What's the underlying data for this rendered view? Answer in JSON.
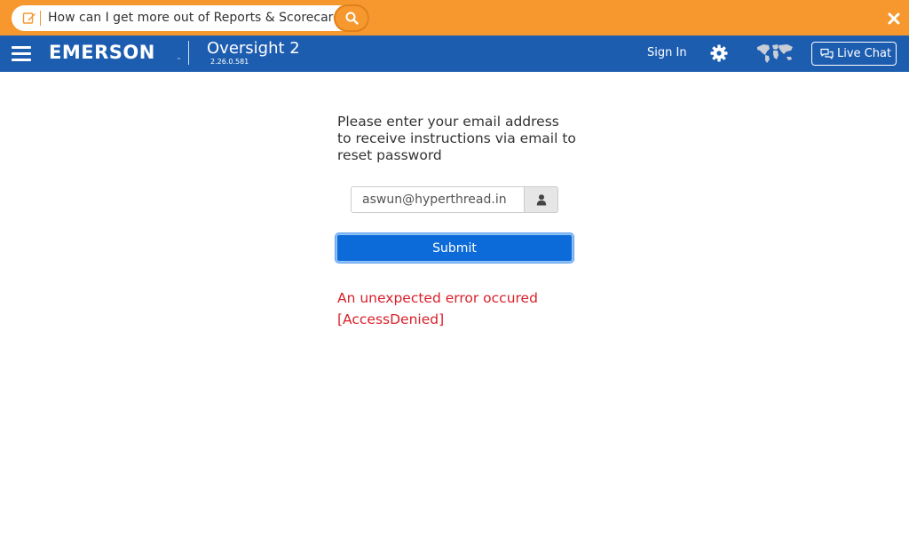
{
  "help_bar": {
    "query": "How can I get more out of Reports & Scorecards?",
    "accent_color": "#f7982f",
    "icons": {
      "edit": "edit-icon",
      "search": "search-icon",
      "close": "close-icon"
    }
  },
  "nav": {
    "brand": "EMERSON",
    "brand_tm": "™",
    "product": "Oversight 2",
    "version": "2.26.0.581",
    "sign_in": "Sign In",
    "live_chat": "Live Chat",
    "bg_color": "#1d5db0",
    "icons": {
      "menu": "hamburger-menu-icon",
      "settings": "gear-icon",
      "region": "world-map-icon",
      "chat": "chat-bubbles-icon"
    }
  },
  "form": {
    "instruction": "Please enter your email address to receive instructions via email to reset password",
    "email_value": "aswun@hyperthread.in",
    "email_icon": "user-icon",
    "submit_label": "Submit",
    "error_line1": "An unexpected error occured",
    "error_line2": "[AccessDenied]",
    "error_color": "#d9202a",
    "button_color": "#0d6bd9"
  }
}
